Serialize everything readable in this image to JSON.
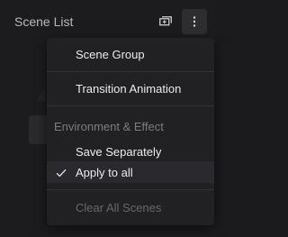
{
  "header": {
    "title": "Scene List",
    "add_icon": "add-scene-icon",
    "more_icon": "more-vertical-icon"
  },
  "menu": {
    "items": [
      {
        "label": "Scene Group",
        "type": "item"
      },
      {
        "label": "Transition Animation",
        "type": "item"
      },
      {
        "label": "Environment & Effect",
        "type": "section"
      },
      {
        "label": "Save Separately",
        "type": "item"
      },
      {
        "label": "Apply to all",
        "type": "item",
        "checked": true
      },
      {
        "label": "Clear All Scenes",
        "type": "item",
        "disabled": true
      }
    ]
  },
  "colors": {
    "background": "#1c1c1e",
    "menu_bg": "#212124",
    "text": "#ececee",
    "muted": "#7c7c80"
  }
}
